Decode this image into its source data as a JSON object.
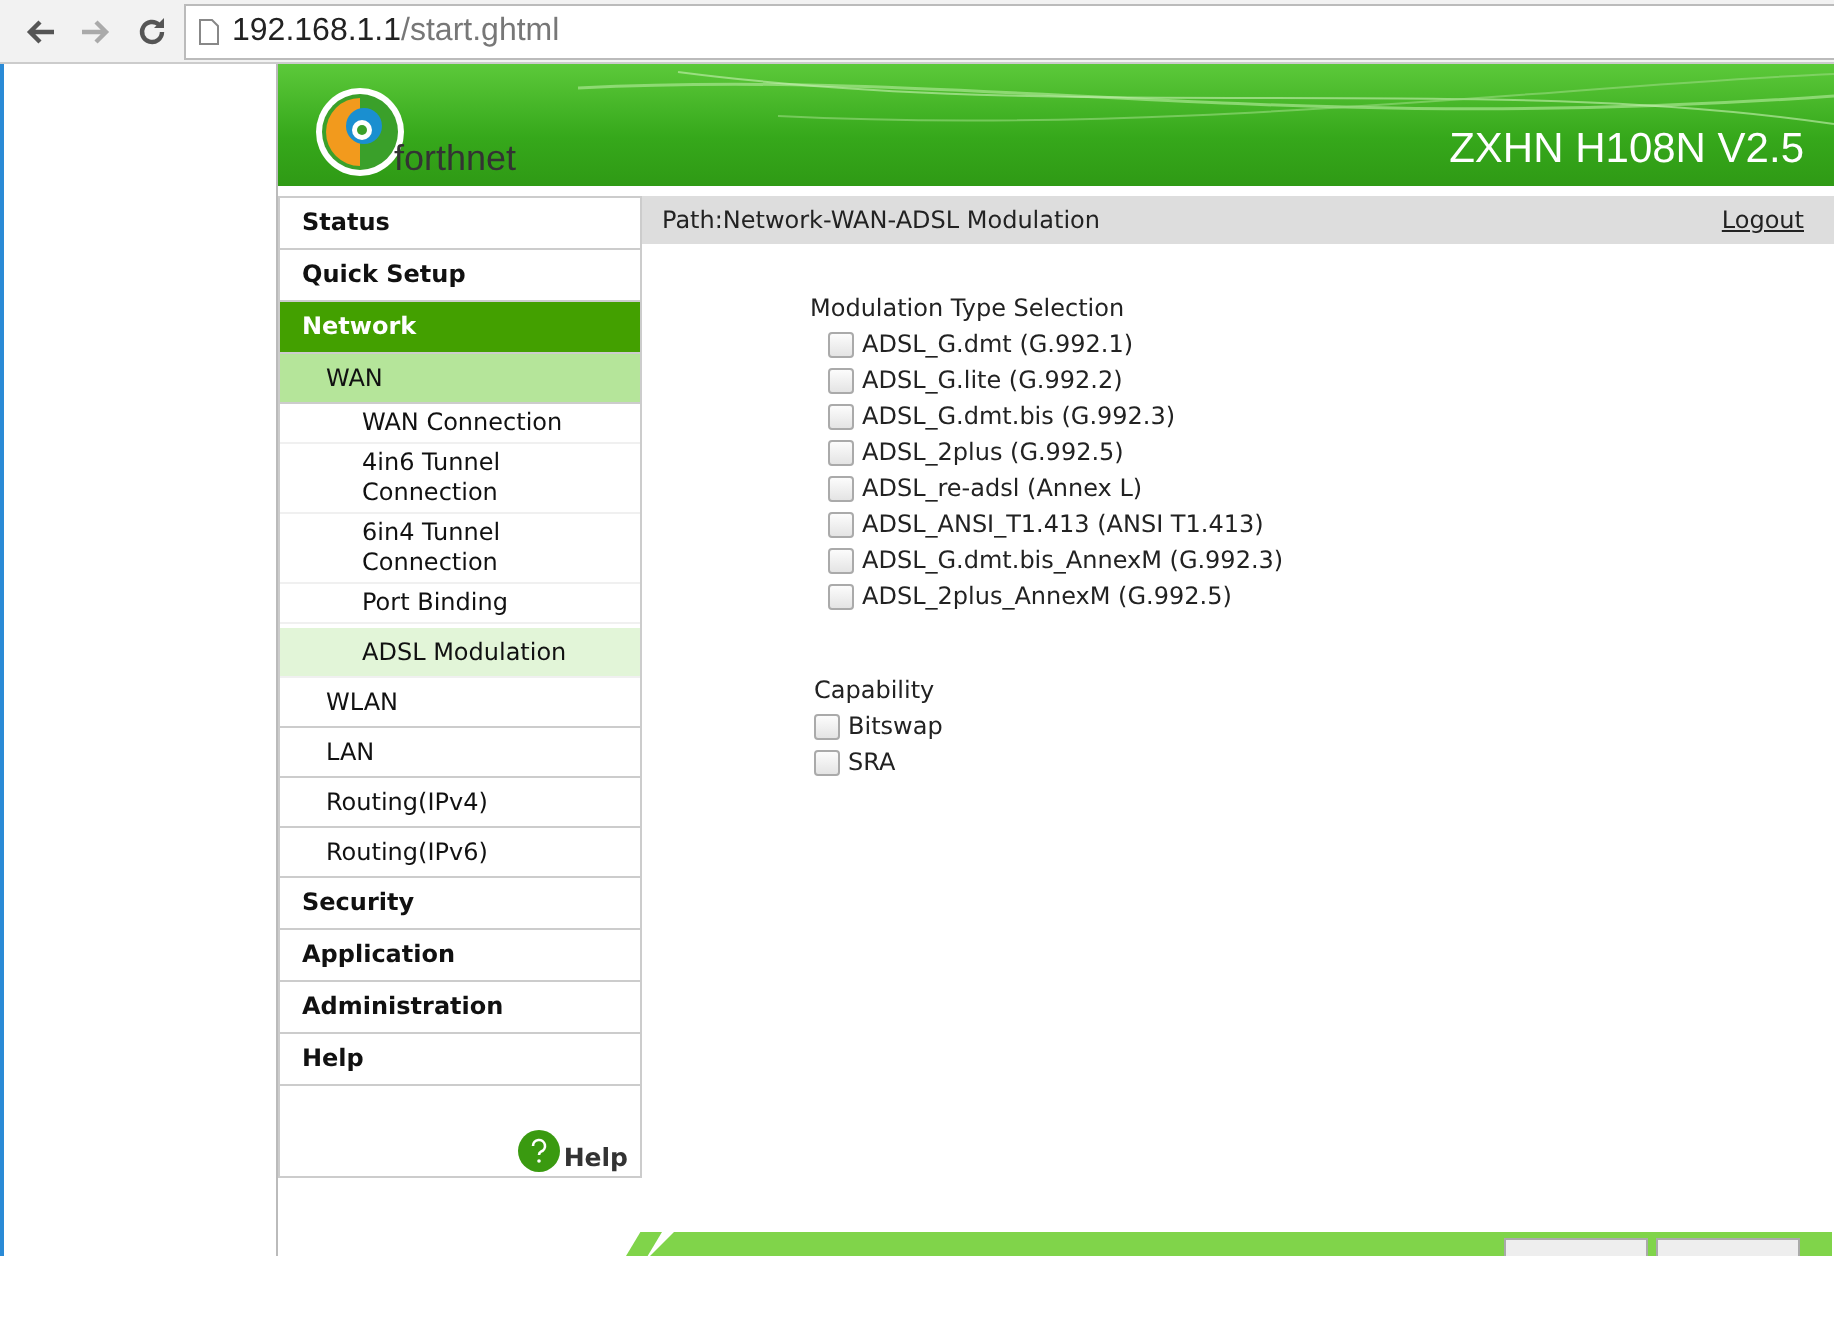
{
  "browser": {
    "url_host": "192.168.1.1",
    "url_path": "/start.ghtml"
  },
  "banner": {
    "brand": "forthnet",
    "model": "ZXHN H108N V2.5"
  },
  "sidebar": {
    "items": [
      {
        "label": "Status",
        "selected": false
      },
      {
        "label": "Quick Setup",
        "selected": false
      },
      {
        "label": "Network",
        "selected": true,
        "children": [
          {
            "label": "WAN",
            "selected": true,
            "children": [
              {
                "label": "WAN Connection",
                "selected": false
              },
              {
                "label": "4in6 Tunnel Connection",
                "selected": false
              },
              {
                "label": "6in4 Tunnel Connection",
                "selected": false
              },
              {
                "label": "Port Binding",
                "selected": false
              },
              {
                "label": "ADSL Modulation",
                "selected": true
              }
            ]
          },
          {
            "label": "WLAN",
            "selected": false
          },
          {
            "label": "LAN",
            "selected": false
          },
          {
            "label": "Routing(IPv4)",
            "selected": false
          },
          {
            "label": "Routing(IPv6)",
            "selected": false
          }
        ]
      },
      {
        "label": "Security",
        "selected": false
      },
      {
        "label": "Application",
        "selected": false
      },
      {
        "label": "Administration",
        "selected": false
      },
      {
        "label": "Help",
        "selected": false
      }
    ],
    "help_label": "Help"
  },
  "path": "Path:Network-WAN-ADSL Modulation",
  "logout": "Logout",
  "modulation": {
    "title": "Modulation Type Selection",
    "options": [
      {
        "label": "ADSL_G.dmt (G.992.1)",
        "checked": false
      },
      {
        "label": "ADSL_G.lite (G.992.2)",
        "checked": false
      },
      {
        "label": "ADSL_G.dmt.bis (G.992.3)",
        "checked": false
      },
      {
        "label": "ADSL_2plus (G.992.5)",
        "checked": false
      },
      {
        "label": "ADSL_re-adsl (Annex L)",
        "checked": false
      },
      {
        "label": "ADSL_ANSI_T1.413 (ANSI T1.413)",
        "checked": false
      },
      {
        "label": "ADSL_G.dmt.bis_AnnexM (G.992.3)",
        "checked": false
      },
      {
        "label": "ADSL_2plus_AnnexM (G.992.5)",
        "checked": false
      }
    ]
  },
  "capability": {
    "title": "Capability",
    "options": [
      {
        "label": "Bitswap",
        "checked": false
      },
      {
        "label": "SRA",
        "checked": false
      }
    ]
  }
}
